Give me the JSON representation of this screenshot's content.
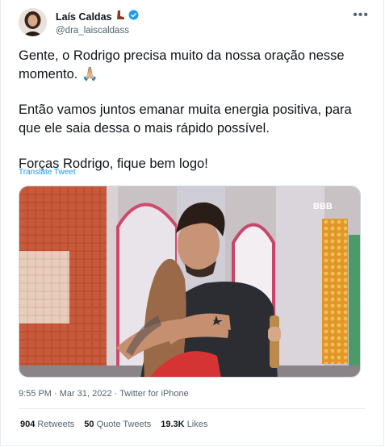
{
  "tweet": {
    "author_name": "Laís Caldas",
    "author_handle": "@dra_laiscaldass",
    "more_label": "•••",
    "text_lines": [
      "Gente, o Rodrigo precisa muito da nossa oração nesse momento. 🙏🏼",
      "Então vamos juntos emanar muita energia positiva, para que ele saia dessa o mais rápido possível.",
      "Forças Rodrigo, fique bem logo!"
    ],
    "translate_label": "Translate Tweet",
    "media_badge": "BBB",
    "time": "9:55 PM",
    "date": "Mar 31, 2022",
    "source": "Twitter for iPhone",
    "separator": "·"
  },
  "stats": {
    "retweets_count": "904",
    "retweets_label": "Retweets",
    "quotes_count": "50",
    "quotes_label": "Quote Tweets",
    "likes_count": "19.3K",
    "likes_label": "Likes"
  },
  "colors": {
    "link": "#1d9bf0",
    "verified": "#1d9bf0",
    "secondary_text": "#536471"
  }
}
